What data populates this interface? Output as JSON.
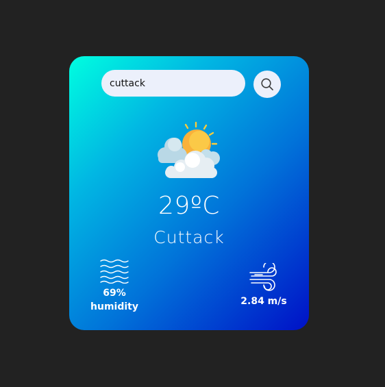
{
  "search": {
    "value": "cuttack",
    "button_icon": "search-icon"
  },
  "weather": {
    "icon": "partly-cloudy-icon",
    "temperature": "29ºC",
    "city": "Cuttack"
  },
  "humidity": {
    "icon": "humidity-waves-icon",
    "value": "69%",
    "label": "humidity"
  },
  "wind": {
    "icon": "wind-icon",
    "value": "2.84 m/s"
  },
  "colors": {
    "background": "#222222",
    "card_gradient_start": "#00fee0",
    "card_gradient_end": "#0011c7",
    "input_bg": "#ecf0fb"
  }
}
